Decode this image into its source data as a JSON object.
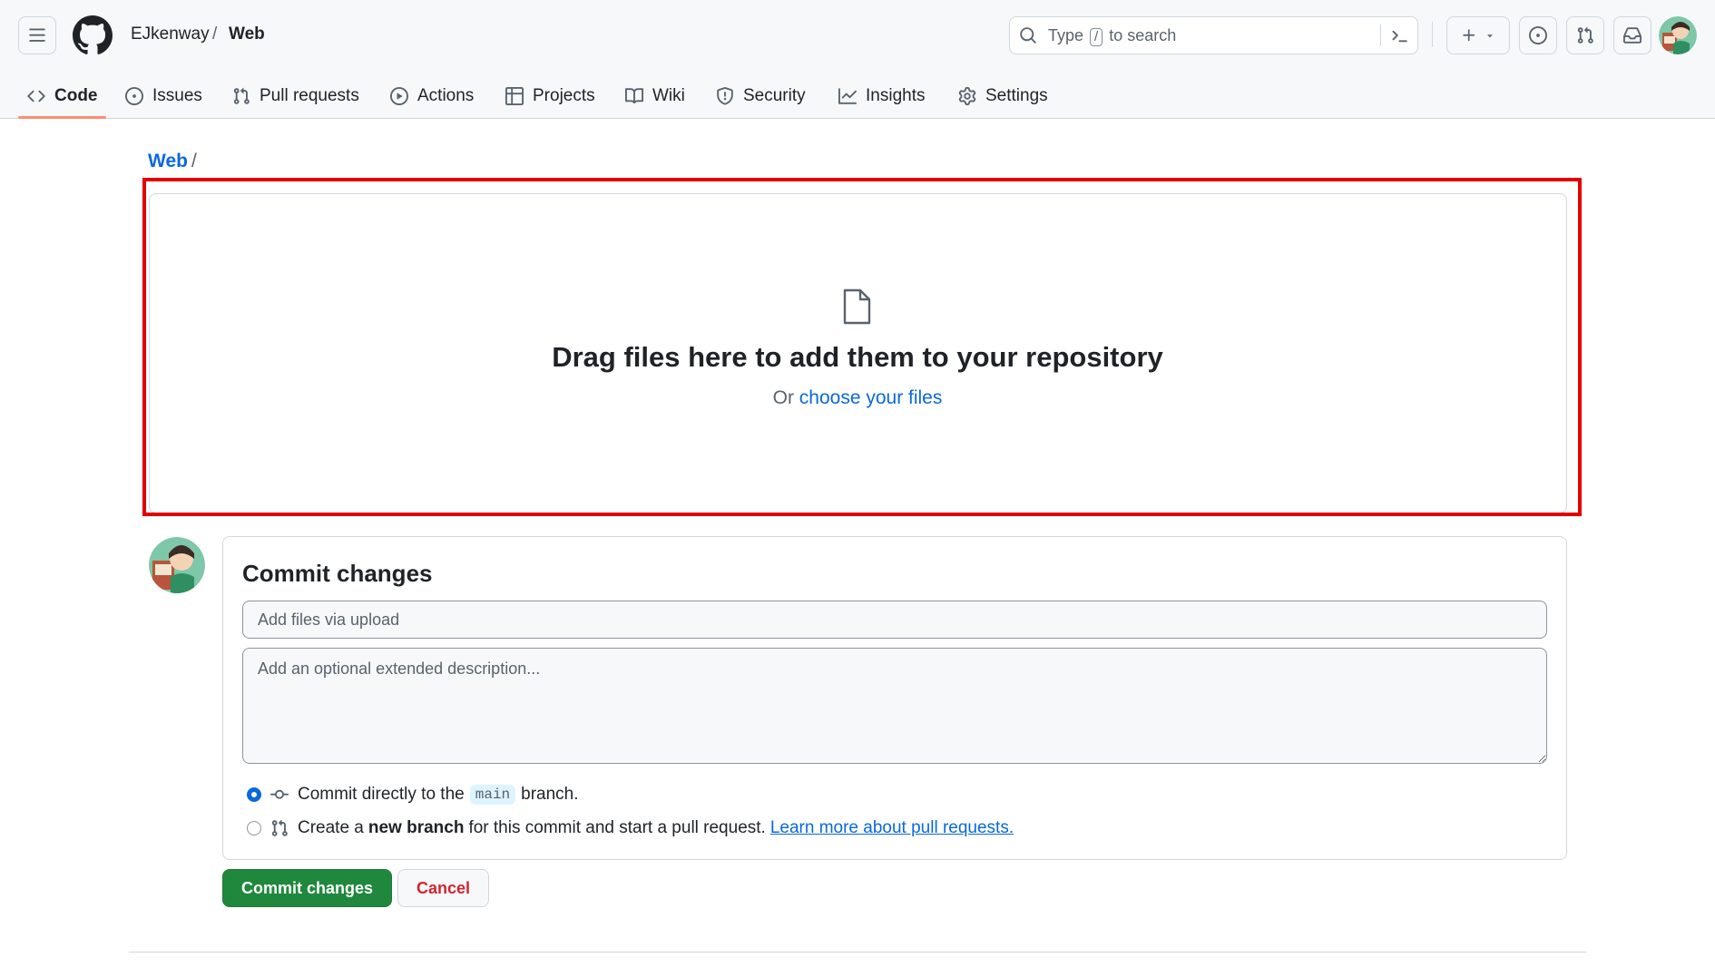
{
  "header": {
    "owner": "EJkenway",
    "separator": "/",
    "repo": "Web",
    "search": {
      "prefix": "Type",
      "key": "/",
      "suffix": "to search"
    },
    "plus_label": "+"
  },
  "tabs": [
    {
      "label": "Code",
      "icon": "code-icon",
      "active": true
    },
    {
      "label": "Issues",
      "icon": "issue-icon"
    },
    {
      "label": "Pull requests",
      "icon": "pull-request-icon"
    },
    {
      "label": "Actions",
      "icon": "play-icon"
    },
    {
      "label": "Projects",
      "icon": "table-icon"
    },
    {
      "label": "Wiki",
      "icon": "book-icon"
    },
    {
      "label": "Security",
      "icon": "shield-icon"
    },
    {
      "label": "Insights",
      "icon": "graph-icon"
    },
    {
      "label": "Settings",
      "icon": "gear-icon"
    }
  ],
  "breadcrumb": {
    "repo_link": "Web",
    "separator": "/"
  },
  "dropzone": {
    "title": "Drag files here to add them to your repository",
    "prefix": "Or",
    "link": "choose your files"
  },
  "commit": {
    "title": "Commit changes",
    "summary_placeholder": "Add files via upload",
    "description_placeholder": "Add an optional extended description...",
    "option_direct": {
      "before": "Commit directly to the",
      "branch": "main",
      "after": "branch."
    },
    "option_new_branch": {
      "before": "Create a",
      "bold": "new branch",
      "after": "for this commit and start a pull request.",
      "link": "Learn more about pull requests."
    },
    "commit_button": "Commit changes",
    "cancel_button": "Cancel"
  },
  "colors": {
    "accent": "#0969da",
    "primary_button": "#1f883d",
    "danger": "#d1242f",
    "highlight": "#e30000",
    "active_tab": "#fd8c73"
  }
}
